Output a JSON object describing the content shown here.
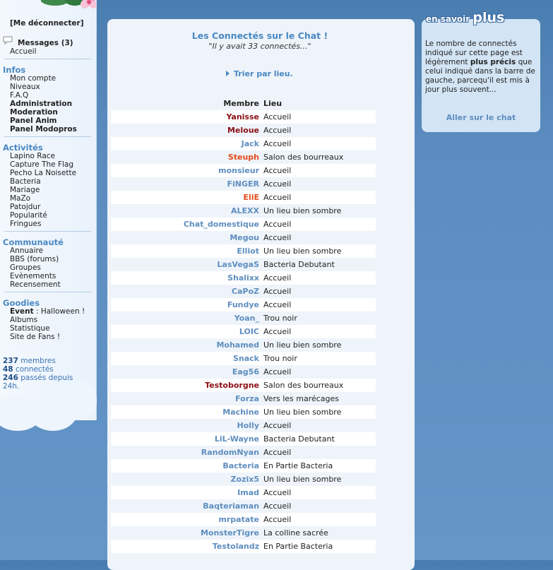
{
  "sidebar": {
    "logout": "[Me déconnecter]",
    "messages": "Messages (3)",
    "home": "Accueil",
    "sections": [
      {
        "title": "Infos",
        "items": [
          {
            "label": "Mon compte",
            "bold": false
          },
          {
            "label": "Niveaux",
            "bold": false
          },
          {
            "label": "F.A.Q",
            "bold": false
          },
          {
            "label": "Administration",
            "bold": true
          },
          {
            "label": "Moderation",
            "bold": true
          },
          {
            "label": "Panel Anim",
            "bold": true
          },
          {
            "label": "Panel Modopros",
            "bold": true
          }
        ]
      },
      {
        "title": "Activités",
        "items": [
          {
            "label": "Lapino Race",
            "bold": false
          },
          {
            "label": "Capture The Flag",
            "bold": false
          },
          {
            "label": "Pecho La Noisette",
            "bold": false
          },
          {
            "label": "Bacteria",
            "bold": false
          },
          {
            "label": "Mariage",
            "bold": false
          },
          {
            "label": "MaZo",
            "bold": false
          },
          {
            "label": "Patojdur",
            "bold": false
          },
          {
            "label": "Popularité",
            "bold": false
          },
          {
            "label": "Fringues",
            "bold": false
          }
        ]
      },
      {
        "title": "Communauté",
        "items": [
          {
            "label": "Annuaire",
            "bold": false
          },
          {
            "label": "BBS (forums)",
            "bold": false
          },
          {
            "label": "Groupes",
            "bold": false
          },
          {
            "label": "Evènements",
            "bold": false
          },
          {
            "label": "Recensement",
            "bold": false
          }
        ]
      },
      {
        "title": "Goodies",
        "items": [
          {
            "label": "Event",
            "suffix": " : Halloween !",
            "bold": true
          },
          {
            "label": "Albums",
            "bold": false
          },
          {
            "label": "Statistique",
            "bold": false
          },
          {
            "label": "Site de Fans !",
            "bold": false
          }
        ]
      }
    ],
    "stats": {
      "members_count": "237",
      "members_label": " membres",
      "connected_count": "48",
      "connected_label": " connectés",
      "passed_count": "246",
      "passed_label": " passés depuis",
      "passed_label2": "24h."
    }
  },
  "main": {
    "title": "Les Connectés sur le Chat !",
    "subtitle_pre": "\"Il y avait ",
    "subtitle_count": "33",
    "subtitle_post": " connectés...\"",
    "sort_link": "Trier par lieu.",
    "col_member": "Membre",
    "col_place": "Lieu",
    "rows": [
      {
        "member": "Yanisse",
        "place": "Accueil",
        "role": "admin"
      },
      {
        "member": "Meloue",
        "place": "Accueil",
        "role": "admin"
      },
      {
        "member": "Jack",
        "place": "Accueil",
        "role": "user"
      },
      {
        "member": "Steuph",
        "place": "Salon des bourreaux",
        "role": "mod"
      },
      {
        "member": "monsieur",
        "place": "Accueil",
        "role": "user"
      },
      {
        "member": "FiNGER",
        "place": "Accueil",
        "role": "user"
      },
      {
        "member": "EliE",
        "place": "Accueil",
        "role": "mod"
      },
      {
        "member": "ALEXX",
        "place": "Un lieu bien sombre",
        "role": "user"
      },
      {
        "member": "Chat_domestique",
        "place": "Accueil",
        "role": "user"
      },
      {
        "member": "Megou",
        "place": "Accueil",
        "role": "user"
      },
      {
        "member": "Elliot",
        "place": "Un lieu bien sombre",
        "role": "user"
      },
      {
        "member": "LasVegaS",
        "place": "Bacteria Debutant",
        "role": "user"
      },
      {
        "member": "Shalixx",
        "place": "Accueil",
        "role": "user"
      },
      {
        "member": "CaPoZ",
        "place": "Accueil",
        "role": "user"
      },
      {
        "member": "Fundye",
        "place": "Accueil",
        "role": "user"
      },
      {
        "member": "Yoan_",
        "place": "Trou noir",
        "role": "user"
      },
      {
        "member": "LOIC",
        "place": "Accueil",
        "role": "user"
      },
      {
        "member": "Mohamed",
        "place": "Un lieu bien sombre",
        "role": "user"
      },
      {
        "member": "Snack",
        "place": "Trou noir",
        "role": "user"
      },
      {
        "member": "Eag56",
        "place": "Accueil",
        "role": "user"
      },
      {
        "member": "Testoborgne",
        "place": "Salon des bourreaux",
        "role": "admin"
      },
      {
        "member": "Forza",
        "place": "Vers les marécages",
        "role": "user"
      },
      {
        "member": "Machine",
        "place": "Un lieu bien sombre",
        "role": "user"
      },
      {
        "member": "Holly",
        "place": "Accueil",
        "role": "user"
      },
      {
        "member": "LiL-Wayne",
        "place": "Bacteria Debutant",
        "role": "user"
      },
      {
        "member": "RandomNyan",
        "place": "Accueil",
        "role": "user"
      },
      {
        "member": "Bacteria",
        "place": "En Partie Bacteria",
        "role": "user"
      },
      {
        "member": "Zozix5",
        "place": "Un lieu bien sombre",
        "role": "user"
      },
      {
        "member": "Imad",
        "place": "Accueil",
        "role": "user"
      },
      {
        "member": "Baqteriaman",
        "place": "Accueil",
        "role": "user"
      },
      {
        "member": "mrpatate",
        "place": "Accueil",
        "role": "user"
      },
      {
        "member": "MonsterTigre",
        "place": "La colline sacrée",
        "role": "user"
      },
      {
        "member": "Testolandz",
        "place": "En Partie Bacteria",
        "role": "user"
      }
    ]
  },
  "right": {
    "title_small": "en savoir ",
    "title_big": "plus",
    "text_1": "Le nombre de connectés indiqué sur cette page est légèrement ",
    "text_bold": "plus précis",
    "text_2": " que celui indiqué dans la barre de gauche, parcequ'il est mis à jour plus souvent...",
    "link": "Aller sur le chat"
  },
  "colors": {
    "accent": "#4a88c2",
    "admin": "#8b0f14",
    "moderator": "#e34a1d",
    "member": "#5f8ebf"
  }
}
